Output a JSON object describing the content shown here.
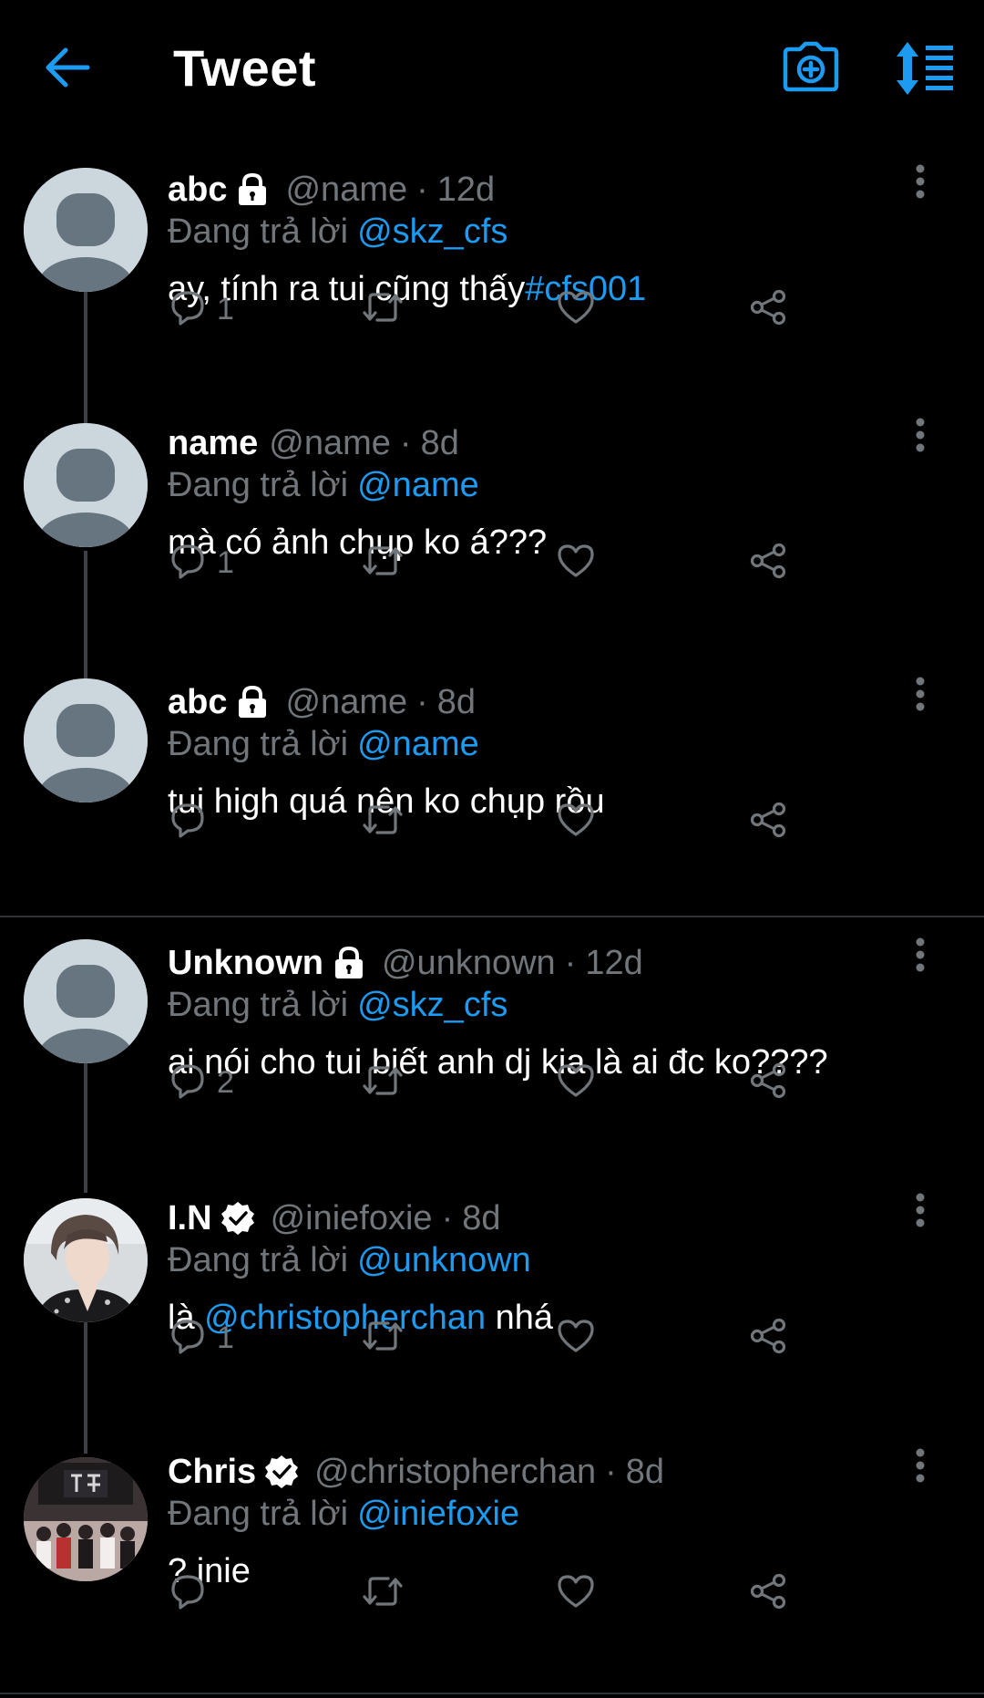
{
  "header": {
    "title": "Tweet",
    "accent": "#1d9bf0"
  },
  "reply_prefix": "Đang trả lời",
  "threads": [
    {
      "tweets": [
        {
          "name": "abc",
          "locked": true,
          "verified": false,
          "handle": "@name",
          "dot": "·",
          "age": "12d",
          "reply_to": "@skz_cfs",
          "text": "ay, tính ra tui cũng thấy ",
          "hashtag": "#cfs001",
          "reply_count": "1",
          "avatar": "default-avatar"
        },
        {
          "name": "name",
          "locked": false,
          "verified": false,
          "handle": "@name",
          "dot": "·",
          "age": "8d",
          "reply_to": "@name",
          "text": "mà có ảnh chụp ko á???",
          "reply_count": "1",
          "avatar": "default-avatar"
        },
        {
          "name": "abc",
          "locked": true,
          "verified": false,
          "handle": "@name",
          "dot": "·",
          "age": "8d",
          "reply_to": "@name",
          "text": "tui high quá nên ko chụp rồu",
          "reply_count": "",
          "avatar": "default-avatar"
        }
      ]
    },
    {
      "tweets": [
        {
          "name": "Unknown",
          "locked": true,
          "verified": false,
          "handle": "@unknown",
          "dot": "·",
          "age": "12d",
          "reply_to": "@skz_cfs",
          "text": "ai nói cho tui biết anh dj kia là ai đc ko????",
          "reply_count": "2",
          "avatar": "default-avatar"
        },
        {
          "name": "I.N",
          "locked": false,
          "verified": true,
          "handle": "@iniefoxie",
          "dot": "·",
          "age": "8d",
          "reply_to": "@unknown",
          "text_pre": "là ",
          "mention": "@christopherchan",
          "text_post": " nhá",
          "reply_count": "1",
          "avatar": "photo-avatar"
        },
        {
          "name": "Chris",
          "locked": false,
          "verified": true,
          "handle": "@christopherchan",
          "dot": "·",
          "age": "8d",
          "reply_to": "@iniefoxie",
          "text": "? inie",
          "reply_count": "",
          "avatar": "photo-avatar"
        }
      ]
    }
  ]
}
